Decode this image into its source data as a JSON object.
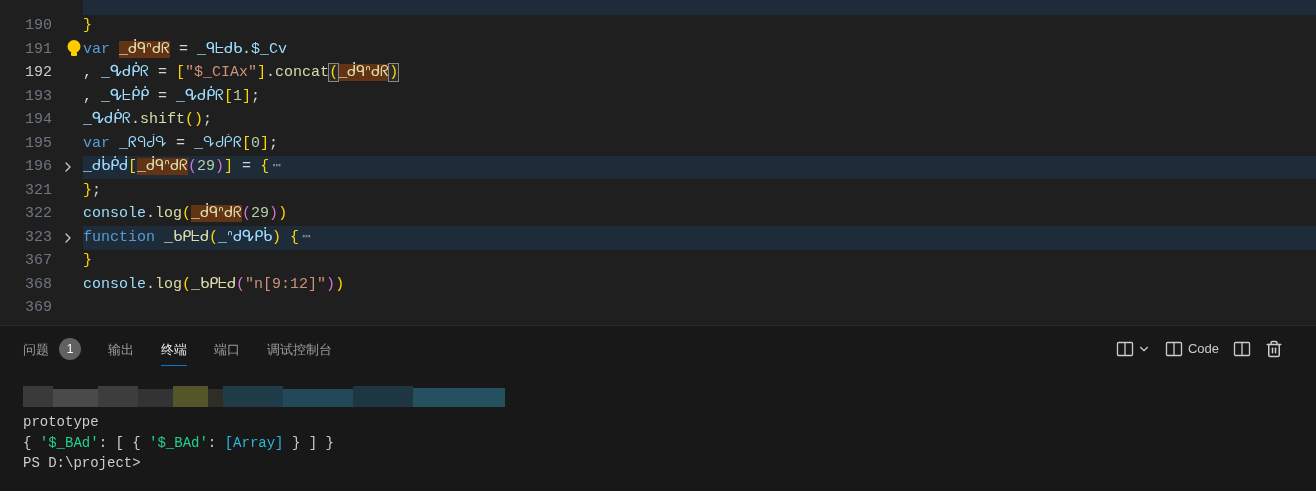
{
  "editor": {
    "lines": [
      {
        "folded": true,
        "current": false,
        "lightbulb": false
      },
      {
        "number": "190",
        "folded": false,
        "current": false,
        "lightbulb": false,
        "tokens": [
          {
            "text": "}",
            "kind": "bracket"
          }
        ]
      },
      {
        "number": "191",
        "folded": false,
        "current": false,
        "lightbulb": true,
        "tokens": [
          {
            "text": "var ",
            "kind": "keyword"
          },
          {
            "text": "_ᑰᑫᐢᑯᖇ",
            "kind": "occurrence"
          },
          {
            "text": " = ",
            "kind": "plain"
          },
          {
            "text": "_ᑫᖶᑯᑲ",
            "kind": "variable"
          },
          {
            "text": ".",
            "kind": "plain"
          },
          {
            "text": "$_Cv",
            "kind": "variable"
          }
        ]
      },
      {
        "number": "192",
        "folded": false,
        "current": true,
        "lightbulb": false,
        "tokens": [
          {
            "text": ", ",
            "kind": "plain"
          },
          {
            "text": "_ᕴᑯᑮᖇ",
            "kind": "variable"
          },
          {
            "text": " = ",
            "kind": "plain"
          },
          {
            "text": "[",
            "kind": "bracket"
          },
          {
            "text": "\"$_CIAx\"",
            "kind": "string"
          },
          {
            "text": "]",
            "kind": "bracket"
          },
          {
            "text": ".",
            "kind": "plain"
          },
          {
            "text": "concat",
            "kind": "function"
          },
          {
            "text": "(",
            "kind": "matched"
          },
          {
            "text": "_ᑰᑫᐢᑯᖇ",
            "kind": "occurrence"
          },
          {
            "text": ")",
            "kind": "matched"
          }
        ]
      },
      {
        "number": "193",
        "folded": false,
        "current": false,
        "lightbulb": false,
        "tokens": [
          {
            "text": ", ",
            "kind": "plain"
          },
          {
            "text": "_ᕴᖶᑮᑮ",
            "kind": "variable"
          },
          {
            "text": " = ",
            "kind": "plain"
          },
          {
            "text": "_ᕴᑯᑮᖇ",
            "kind": "variable"
          },
          {
            "text": "[",
            "kind": "bracket"
          },
          {
            "text": "1",
            "kind": "number"
          },
          {
            "text": "]",
            "kind": "bracket"
          },
          {
            "text": ";",
            "kind": "plain"
          }
        ]
      },
      {
        "number": "194",
        "folded": false,
        "current": false,
        "lightbulb": false,
        "tokens": [
          {
            "text": "_ᕴᑯᑮᖇ",
            "kind": "variable"
          },
          {
            "text": ".",
            "kind": "plain"
          },
          {
            "text": "shift",
            "kind": "function"
          },
          {
            "text": "()",
            "kind": "bracket"
          },
          {
            "text": ";",
            "kind": "plain"
          }
        ]
      },
      {
        "number": "195",
        "folded": false,
        "current": false,
        "lightbulb": false,
        "tokens": [
          {
            "text": "var ",
            "kind": "keyword"
          },
          {
            "text": "_ᖇᑫᑰᕴ",
            "kind": "variable"
          },
          {
            "text": " = ",
            "kind": "plain"
          },
          {
            "text": "_ᕴᑯᑮᖇ",
            "kind": "variable"
          },
          {
            "text": "[",
            "kind": "bracket"
          },
          {
            "text": "0",
            "kind": "number"
          },
          {
            "text": "]",
            "kind": "bracket"
          },
          {
            "text": ";",
            "kind": "plain"
          }
        ]
      },
      {
        "number": "196",
        "folded": true,
        "current": false,
        "lightbulb": false,
        "tokens": [
          {
            "text": "_ᑯᑳᑮᑰ",
            "kind": "variable"
          },
          {
            "text": "[",
            "kind": "bracket"
          },
          {
            "text": "_ᑰᑫᐢᑯᖇ",
            "kind": "occurrence"
          },
          {
            "text": "(",
            "kind": "inner"
          },
          {
            "text": "29",
            "kind": "number"
          },
          {
            "text": ")",
            "kind": "inner"
          },
          {
            "text": "]",
            "kind": "bracket"
          },
          {
            "text": " = ",
            "kind": "plain"
          },
          {
            "text": "{",
            "kind": "bracket"
          },
          {
            "text": "⋯",
            "kind": "fold"
          }
        ]
      },
      {
        "number": "321",
        "folded": false,
        "current": false,
        "lightbulb": false,
        "tokens": [
          {
            "text": "}",
            "kind": "bracket"
          },
          {
            "text": ";",
            "kind": "plain"
          }
        ]
      },
      {
        "number": "322",
        "folded": false,
        "current": false,
        "lightbulb": false,
        "tokens": [
          {
            "text": "console",
            "kind": "variable"
          },
          {
            "text": ".",
            "kind": "plain"
          },
          {
            "text": "log",
            "kind": "function"
          },
          {
            "text": "(",
            "kind": "bracket"
          },
          {
            "text": "_ᑰᑫᐢᑯᖇ",
            "kind": "occurrence"
          },
          {
            "text": "(",
            "kind": "inner"
          },
          {
            "text": "29",
            "kind": "number"
          },
          {
            "text": ")",
            "kind": "inner"
          },
          {
            "text": ")",
            "kind": "bracket"
          }
        ]
      },
      {
        "number": "323",
        "folded": true,
        "current": false,
        "lightbulb": false,
        "tokens": [
          {
            "text": "function ",
            "kind": "keyword"
          },
          {
            "text": "_ᑲᑭᖶᑯ",
            "kind": "function"
          },
          {
            "text": "(",
            "kind": "bracket"
          },
          {
            "text": "_ᐢᑯᕴᑭᑳ",
            "kind": "variable"
          },
          {
            "text": ")",
            "kind": "bracket"
          },
          {
            "text": " {",
            "kind": "bracket"
          },
          {
            "text": "⋯",
            "kind": "fold"
          }
        ]
      },
      {
        "number": "367",
        "folded": false,
        "current": false,
        "lightbulb": false,
        "tokens": [
          {
            "text": "}",
            "kind": "bracket"
          }
        ]
      },
      {
        "number": "368",
        "folded": false,
        "current": false,
        "lightbulb": false,
        "tokens": [
          {
            "text": "console",
            "kind": "variable"
          },
          {
            "text": ".",
            "kind": "plain"
          },
          {
            "text": "log",
            "kind": "function"
          },
          {
            "text": "(",
            "kind": "bracket"
          },
          {
            "text": "_ᑲᑭᖶᑯ",
            "kind": "function"
          },
          {
            "text": "(",
            "kind": "inner"
          },
          {
            "text": "\"n[9:12]\"",
            "kind": "string"
          },
          {
            "text": ")",
            "kind": "inner"
          },
          {
            "text": ")",
            "kind": "bracket"
          }
        ]
      },
      {
        "number": "369",
        "folded": false,
        "current": false,
        "lightbulb": false
      }
    ]
  },
  "panel": {
    "tabs": [
      {
        "label": "问题",
        "selected": false,
        "badge": "1"
      },
      {
        "label": "输出",
        "selected": false
      },
      {
        "label": "终端",
        "selected": true
      },
      {
        "label": "端口",
        "selected": false
      },
      {
        "label": "调试控制台",
        "selected": false
      }
    ],
    "terminal_name": "Code",
    "terminal": [
      {
        "kind": "redacted"
      },
      {
        "kind": "text",
        "tokens": [
          {
            "text": "prototype",
            "kind": "plain"
          }
        ]
      },
      {
        "kind": "text",
        "tokens": [
          {
            "text": "{ ",
            "kind": "plain"
          },
          {
            "text": "'$_BAd'",
            "kind": "string"
          },
          {
            "text": ": [ { ",
            "kind": "plain"
          },
          {
            "text": "'$_BAd'",
            "kind": "string"
          },
          {
            "text": ": ",
            "kind": "plain"
          },
          {
            "text": "[Array]",
            "kind": "special"
          },
          {
            "text": " } ] }",
            "kind": "plain"
          }
        ]
      },
      {
        "kind": "text",
        "tokens": [
          {
            "text": "PS D:\\project>",
            "kind": "plain"
          }
        ]
      }
    ]
  }
}
